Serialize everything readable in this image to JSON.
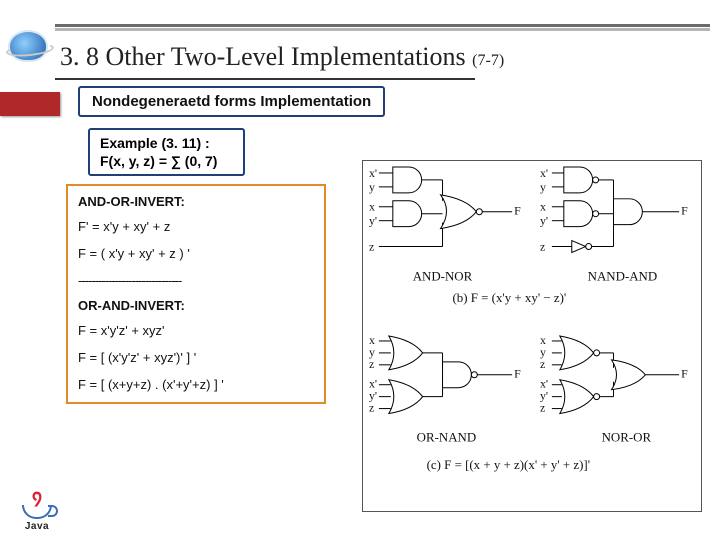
{
  "title": {
    "main": "3. 8 Other Two-Level Implementations ",
    "sub": "(7-7)"
  },
  "section": "Nondegeneraetd forms Implementation",
  "example": {
    "line1": "Example (3. 11) :",
    "line2": "F(x, y, z) = ∑ (0, 7)"
  },
  "forms": {
    "aoi_title": "AND-OR-INVERT:",
    "aoi_eq1": "F' = x'y + xy' + z",
    "aoi_eq2": "F = ( x'y + xy' + z ) '",
    "separator": "-------------------------------",
    "oai_title": "OR-AND-INVERT:",
    "oai_eq1": "F = x'y'z' + xyz'",
    "oai_eq2": "F = [ (x'y'z' + xyz')' ] '",
    "oai_eq3": "F = [ (x+y+z) . (x'+y'+z) ] '"
  },
  "diagram": {
    "inputs_top": [
      "x'",
      "y",
      "x",
      "y'",
      "z"
    ],
    "label_and_nor": "AND-NOR",
    "label_nand_and": "NAND-AND",
    "caption_b": "(b) F = (x'y + xy' − z)'",
    "label_or_nand": "OR-NAND",
    "label_nor_or": "NOR-OR",
    "caption_c": "(c) F = [(x + y + z)(x' + y' + z)]'"
  },
  "brand": "Java"
}
